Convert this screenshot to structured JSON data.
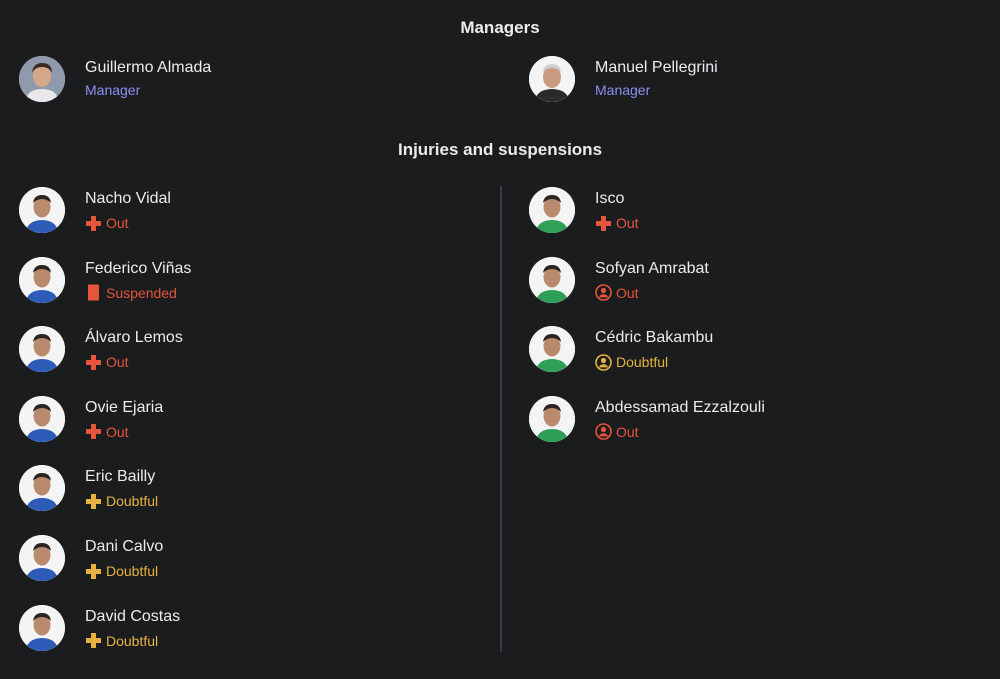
{
  "colors": {
    "background": "#1b1c1e",
    "text": "#ececee",
    "manager_role": "#8d8ff2",
    "out": "#e5553b",
    "doubtful": "#e7b340",
    "suspended": "#e5553b",
    "kit_home": "#2d5bb8",
    "kit_away": "#2f9e56"
  },
  "managers": {
    "title": "Managers",
    "items": [
      {
        "name": "Guillermo Almada",
        "role": "Manager"
      },
      {
        "name": "Manuel Pellegrini",
        "role": "Manager"
      }
    ]
  },
  "injuries": {
    "title": "Injuries and suspensions",
    "home": [
      {
        "name": "Nacho Vidal",
        "status": "Out",
        "icon": "injury-cross-icon"
      },
      {
        "name": "Federico Viñas",
        "status": "Suspended",
        "icon": "red-card-icon"
      },
      {
        "name": "Álvaro Lemos",
        "status": "Out",
        "icon": "injury-cross-icon"
      },
      {
        "name": "Ovie Ejaria",
        "status": "Out",
        "icon": "injury-cross-icon"
      },
      {
        "name": "Eric Bailly",
        "status": "Doubtful",
        "icon": "injury-cross-icon"
      },
      {
        "name": "Dani Calvo",
        "status": "Doubtful",
        "icon": "injury-cross-icon"
      },
      {
        "name": "David Costas",
        "status": "Doubtful",
        "icon": "injury-cross-icon"
      }
    ],
    "away": [
      {
        "name": "Isco",
        "status": "Out",
        "icon": "injury-cross-icon"
      },
      {
        "name": "Sofyan Amrabat",
        "status": "Out",
        "icon": "person-unavailable-icon"
      },
      {
        "name": "Cédric Bakambu",
        "status": "Doubtful",
        "icon": "person-unavailable-icon"
      },
      {
        "name": "Abdessamad Ezzalzouli",
        "status": "Out",
        "icon": "person-unavailable-icon"
      }
    ]
  }
}
